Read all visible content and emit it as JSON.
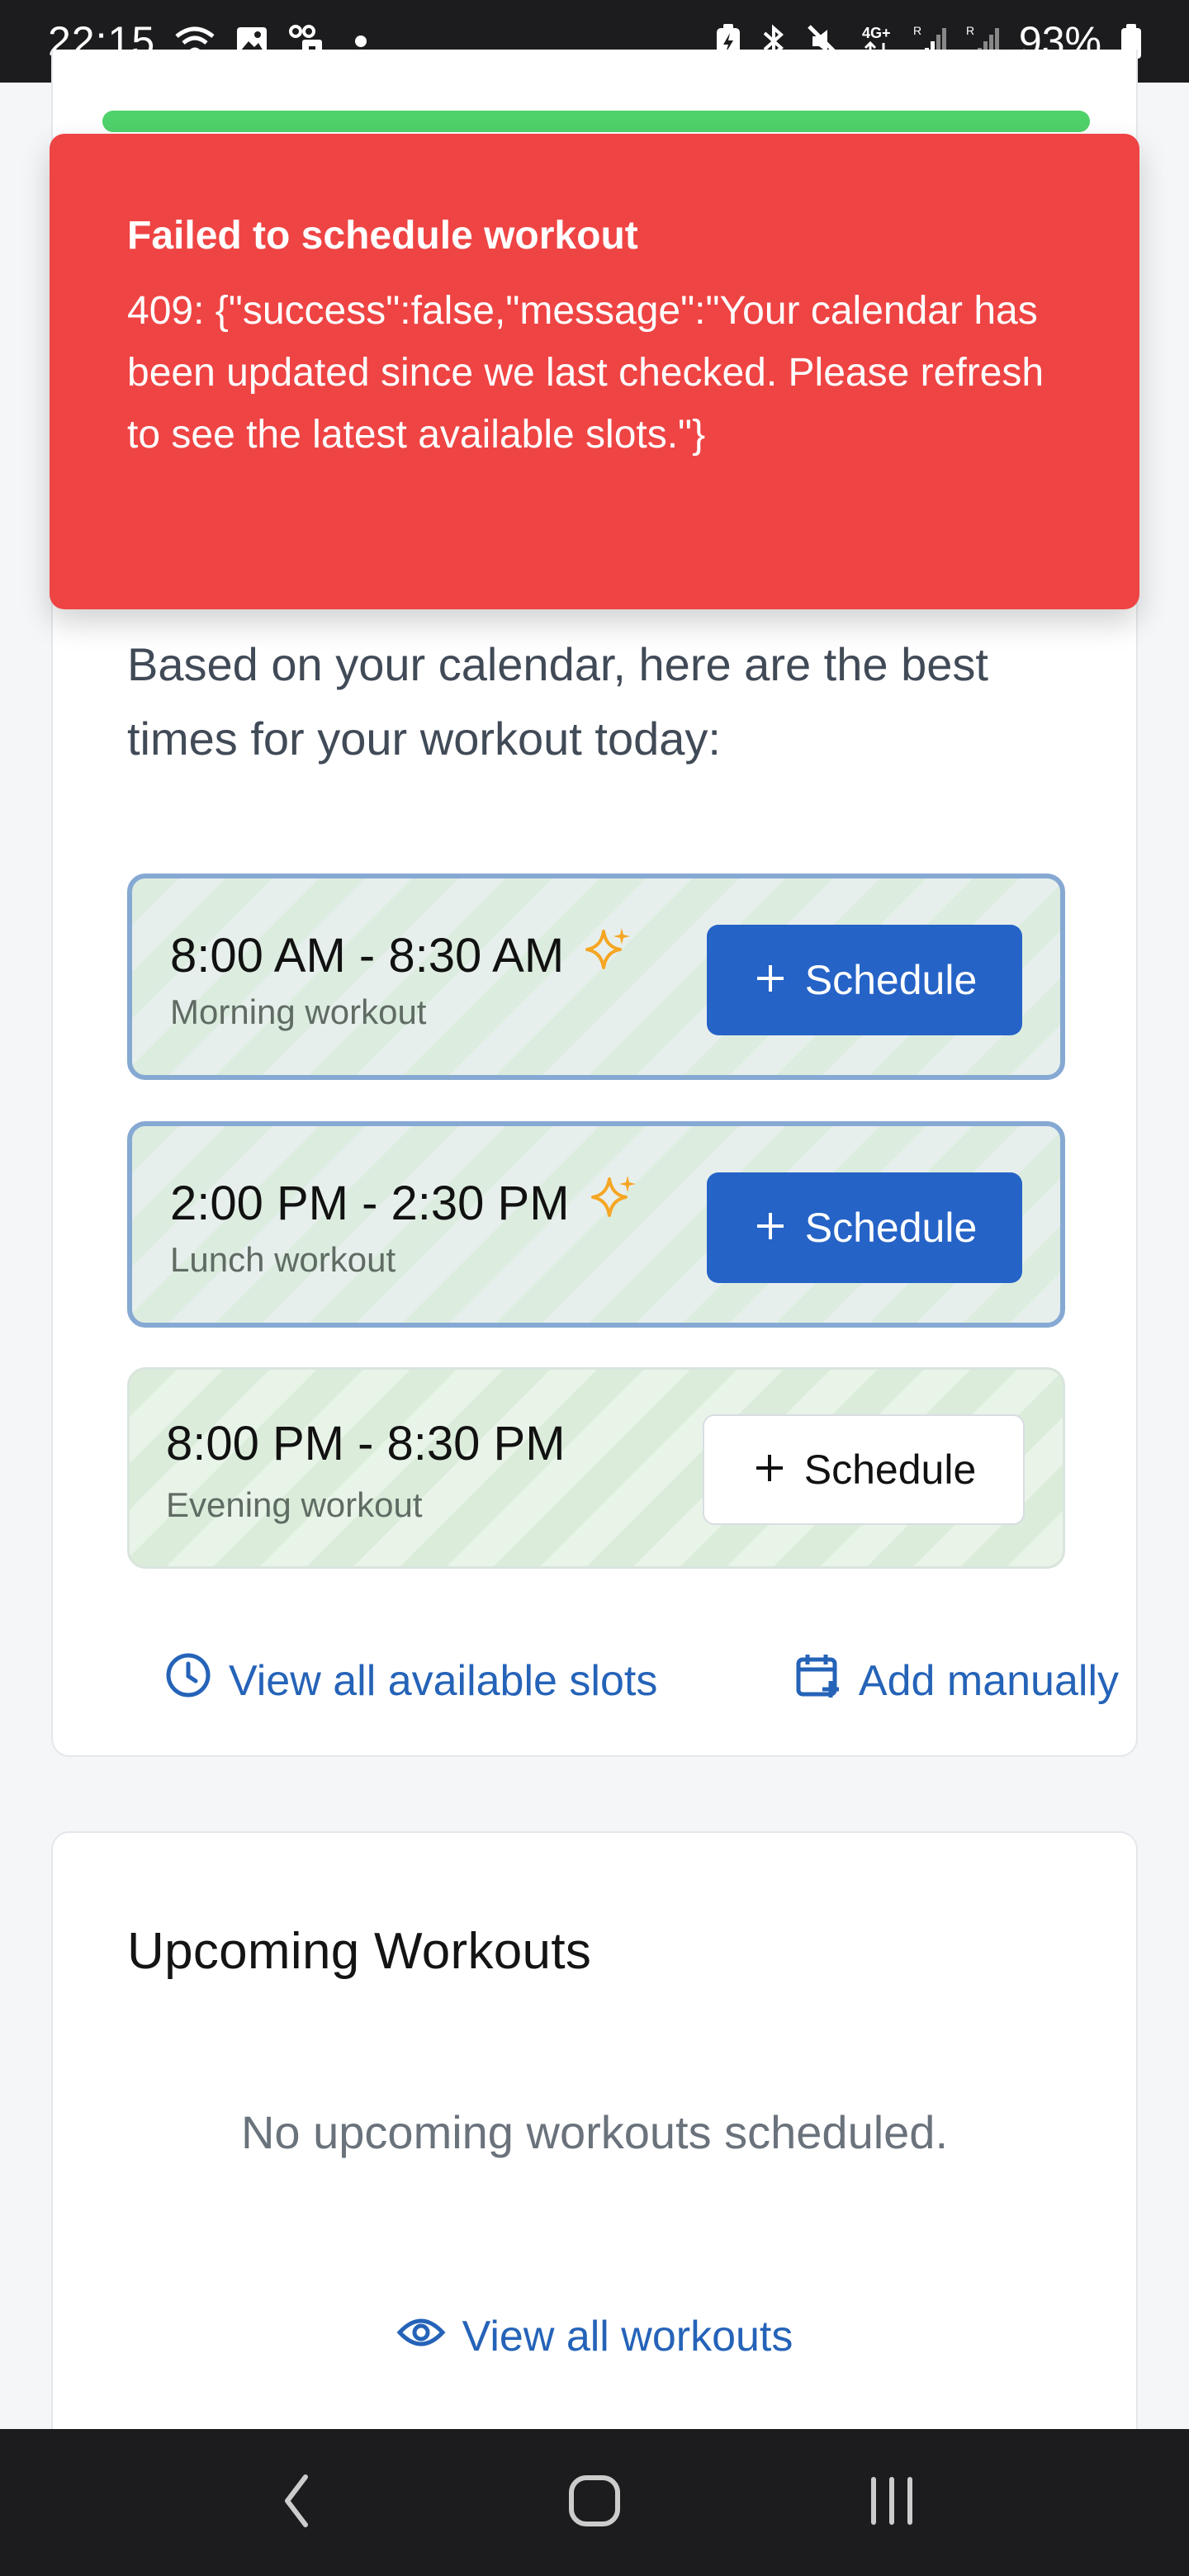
{
  "status_bar": {
    "time": "22:15",
    "battery": "93%",
    "icons": [
      "wifi-icon",
      "image-icon",
      "voicemail-icon",
      "dot-icon",
      "battery-saver-icon",
      "bluetooth-icon",
      "mute-icon",
      "4g-icon",
      "signal-icon",
      "signal-icon",
      "battery-icon"
    ]
  },
  "toast": {
    "title": "Failed to schedule workout",
    "message": "409: {\"success\":false,\"message\":\"Your calendar has been updated since we last checked. Please refresh to see the latest available slots.\"}",
    "color": "#ef4444"
  },
  "suggestions": {
    "intro": "Based on your calendar, here are the best times for your workout today:",
    "slots": [
      {
        "time": "8:00 AM - 8:30 AM",
        "label": "Morning workout",
        "recommended": true,
        "button": "Schedule"
      },
      {
        "time": "2:00 PM - 2:30 PM",
        "label": "Lunch workout",
        "recommended": true,
        "button": "Schedule"
      },
      {
        "time": "8:00 PM - 8:30 PM",
        "label": "Evening workout",
        "recommended": false,
        "button": "Schedule"
      }
    ],
    "view_all_slots": "View all available slots",
    "add_manually": "Add manually"
  },
  "upcoming": {
    "title": "Upcoming Workouts",
    "empty": "No upcoming workouts scheduled.",
    "view_all": "View all workouts"
  },
  "colors": {
    "accent": "#2563c7",
    "progress": "#4fd26a",
    "sparkle": "#f5a623",
    "link": "#2563b8"
  }
}
